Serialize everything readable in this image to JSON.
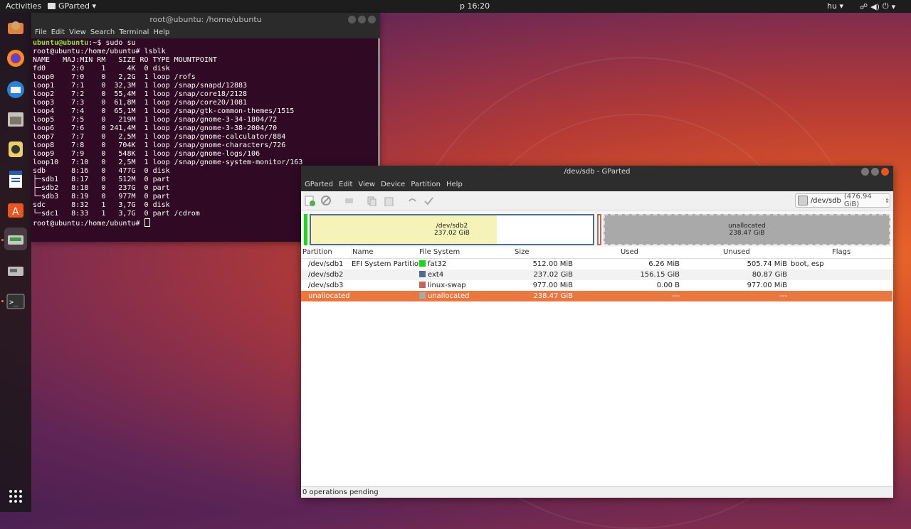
{
  "topbar": {
    "activities": "Activities",
    "app_menu": "GParted ▾",
    "clock": "p 16:20",
    "keyboard": "hu ▾"
  },
  "terminal": {
    "title": "root@ubuntu: /home/ubuntu",
    "menu": [
      "File",
      "Edit",
      "View",
      "Search",
      "Terminal",
      "Help"
    ],
    "prompt_user": "ubuntu@ubuntu",
    "prompt_user_rest": ":~$ sudo su",
    "lines": [
      "root@ubuntu:/home/ubuntu# lsblk",
      "NAME   MAJ:MIN RM   SIZE RO TYPE MOUNTPOINT",
      "fd0      2:0    1     4K  0 disk",
      "loop0    7:0    0   2,2G  1 loop /rofs",
      "loop1    7:1    0  32,3M  1 loop /snap/snapd/12883",
      "loop2    7:2    0  55,4M  1 loop /snap/core18/2128",
      "loop3    7:3    0  61,8M  1 loop /snap/core20/1081",
      "loop4    7:4    0  65,1M  1 loop /snap/gtk-common-themes/1515",
      "loop5    7:5    0   219M  1 loop /snap/gnome-3-34-1804/72",
      "loop6    7:6    0 241,4M  1 loop /snap/gnome-3-38-2004/70",
      "loop7    7:7    0   2,5M  1 loop /snap/gnome-calculator/884",
      "loop8    7:8    0   704K  1 loop /snap/gnome-characters/726",
      "loop9    7:9    0   548K  1 loop /snap/gnome-logs/106",
      "loop10   7:10   0   2,5M  1 loop /snap/gnome-system-monitor/163",
      "sdb      8:16   0   477G  0 disk",
      "├─sdb1   8:17   0   512M  0 part",
      "├─sdb2   8:18   0   237G  0 part",
      "└─sdb3   8:19   0   977M  0 part",
      "sdc      8:32   1   3,7G  0 disk",
      "└─sdc1   8:33   1   3,7G  0 part /cdrom"
    ],
    "last_prompt": "root@ubuntu:/home/ubuntu# "
  },
  "gparted": {
    "title": "/dev/sdb - GParted",
    "menu": [
      "GParted",
      "Edit",
      "View",
      "Device",
      "Partition",
      "Help"
    ],
    "device": "/dev/sdb",
    "device_size": "(476.94 GiB)",
    "map": {
      "sdb2_name": "/dev/sdb2",
      "sdb2_size": "237.02 GiB",
      "sdb2_used_fraction": 0.66,
      "unalloc_name": "unallocated",
      "unalloc_size": "238.47 GiB"
    },
    "columns": [
      "Partition",
      "Name",
      "File System",
      "Size",
      "Used",
      "Unused",
      "Flags"
    ],
    "rows": [
      {
        "partition": "/dev/sdb1",
        "name": "EFI System Partition",
        "fs": "fat32",
        "fs_color": "#18d918",
        "size": "512.00 MiB",
        "used": "6.26 MiB",
        "unused": "505.74 MiB",
        "flags": "boot, esp"
      },
      {
        "partition": "/dev/sdb2",
        "name": "",
        "fs": "ext4",
        "fs_color": "#4e6c8c",
        "size": "237.02 GiB",
        "used": "156.15 GiB",
        "unused": "80.87 GiB",
        "flags": ""
      },
      {
        "partition": "/dev/sdb3",
        "name": "",
        "fs": "linux-swap",
        "fs_color": "#c1665a",
        "size": "977.00 MiB",
        "used": "0.00 B",
        "unused": "977.00 MiB",
        "flags": ""
      },
      {
        "partition": "unallocated",
        "name": "",
        "fs": "unallocated",
        "fs_color": "#a9a9a9",
        "size": "238.47 GiB",
        "used": "---",
        "unused": "---",
        "flags": ""
      }
    ],
    "status": "0 operations pending"
  },
  "colors": {
    "selection": "#e9773f",
    "ubuntu_orange": "#e95420"
  }
}
